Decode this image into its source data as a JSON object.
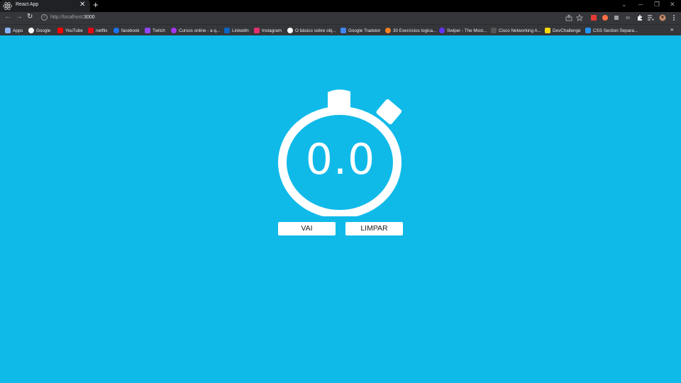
{
  "browser": {
    "tab_title": "React App",
    "tab_close": "✕",
    "new_tab": "+",
    "url_host": "http://localhost",
    "url_port": ":3000",
    "win_minimize": "─",
    "win_restore": "❐",
    "win_close": "✕",
    "win_chevron": "⌄",
    "nav_back": "←",
    "nav_forward": "→",
    "nav_reload": "↻",
    "bookmarks_more": "»"
  },
  "bookmarks": [
    {
      "label": "Apps",
      "color": "#8ab4f8"
    },
    {
      "label": "Google",
      "color": "#ffffff"
    },
    {
      "label": "YouTube",
      "color": "#ff0000"
    },
    {
      "label": "netflix",
      "color": "#e50914"
    },
    {
      "label": "facebook",
      "color": "#1877f2"
    },
    {
      "label": "Twitch",
      "color": "#9146ff"
    },
    {
      "label": "Cursos online - a q...",
      "color": "#a435f0"
    },
    {
      "label": "LinkedIn",
      "color": "#0a66c2"
    },
    {
      "label": "Instagram",
      "color": "#e1306c"
    },
    {
      "label": "O básico sobre obj...",
      "color": "#ffffff"
    },
    {
      "label": "Google Tradutor",
      "color": "#4285f4"
    },
    {
      "label": "30 Exercícios logica...",
      "color": "#f48024"
    },
    {
      "label": "Swiper - The Most...",
      "color": "#6332f6"
    },
    {
      "label": "Cisco Networking A...",
      "color": "#555555"
    },
    {
      "label": "DevChallenge",
      "color": "#f5d90a"
    },
    {
      "label": "CSS Section Separa...",
      "color": "#2196f3"
    }
  ],
  "app": {
    "timer": "0.0",
    "start_label": "VAI",
    "clear_label": "LIMPAR"
  },
  "colors": {
    "background": "#0fbae9",
    "stopwatch": "#ffffff"
  }
}
